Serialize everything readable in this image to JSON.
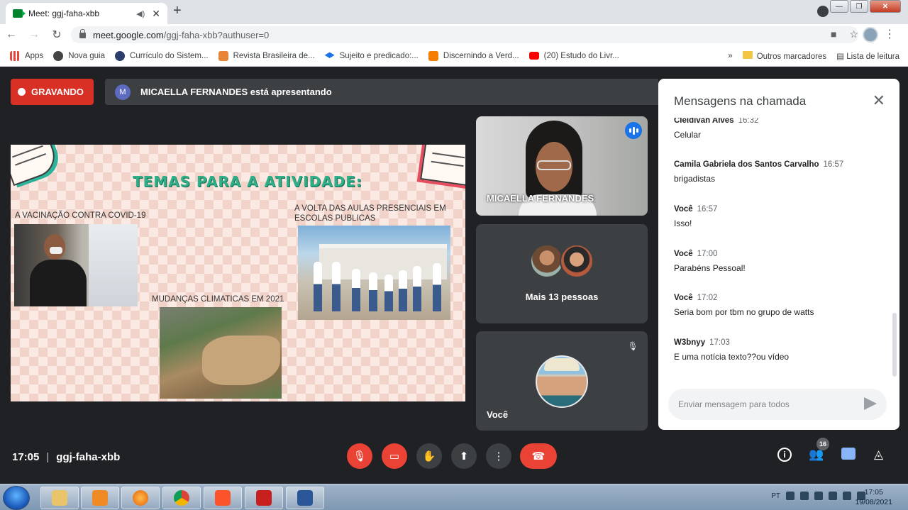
{
  "browser": {
    "tab_title": "Meet: ggj-faha-xbb",
    "url_host": "meet.google.com",
    "url_path": "/ggj-faha-xbb?authuser=0",
    "new_tab_glyph": "+"
  },
  "bookmarks": {
    "items": [
      {
        "label": "Apps",
        "icon": "apps-grid-icon",
        "color": "#e8453c"
      },
      {
        "label": "Nova guia",
        "icon": "chrome-icon",
        "color": "#444"
      },
      {
        "label": "Currículo do Sistem...",
        "icon": "lattes-icon",
        "color": "#2c3e6b"
      },
      {
        "label": "Revista Brasileira de...",
        "icon": "sjr-icon",
        "color": "#e8833a"
      },
      {
        "label": "Sujeito e predicado:...",
        "icon": "graduation-cap-icon",
        "color": "#1a73e8"
      },
      {
        "label": "Discernindo a Verd...",
        "icon": "blogger-icon",
        "color": "#f57d00"
      },
      {
        "label": "(20) Estudo do Livr...",
        "icon": "youtube-icon",
        "color": "#ff0000"
      }
    ],
    "more_glyph": "»",
    "other_label": "Outros marcadores",
    "reading_list_label": "Lista de leitura"
  },
  "meet": {
    "recording_label": "GRAVANDO",
    "presenter_initial": "M",
    "presenting_text": "MICAELLA FERNANDES está apresentando",
    "slide": {
      "title": "TEMAS PARA A ATIVIDADE:",
      "topic1": "A VACINAÇÃO CONTRA COVID-19",
      "topic2": "A VOLTA DAS AULAS PRESENCIAIS EM ESCOLAS PUBLICAS",
      "topic3": "MUDANÇAS CLIMATICAS EM 2021"
    },
    "tiles": {
      "presenter_name": "MICAELLA FERNANDES",
      "more_people": "Mais 13 pessoas",
      "self_name": "Você"
    },
    "meeting_time": "17:05",
    "meeting_code": "ggj-faha-xbb",
    "participants_badge": "16",
    "info_glyph": "i"
  },
  "chat": {
    "title": "Mensagens na chamada",
    "messages": [
      {
        "sender": "Cleidivan Alves",
        "time": "16:32",
        "text": "Celular"
      },
      {
        "sender": "Camila Gabriela dos Santos Carvalho",
        "time": "16:57",
        "text": "brigadistas"
      },
      {
        "sender": "Você",
        "time": "16:57",
        "text": "Isso!"
      },
      {
        "sender": "Você",
        "time": "17:00",
        "text": "Parabéns Pessoal!"
      },
      {
        "sender": "Você",
        "time": "17:02",
        "text": "Seria bom por tbm no grupo de watts"
      },
      {
        "sender": "W3bnyy",
        "time": "17:03",
        "text": "E uma notícia texto??ou vídeo"
      }
    ],
    "input_placeholder": "Enviar mensagem para todos"
  },
  "taskbar": {
    "language": "PT",
    "clock_time": "17:05",
    "clock_date": "19/08/2021"
  },
  "colors": {
    "recording_red": "#d93025",
    "control_red": "#ea4335",
    "meet_bg": "#202124",
    "accent_blue": "#1a73e8",
    "slide_title_green": "#2fae87"
  }
}
